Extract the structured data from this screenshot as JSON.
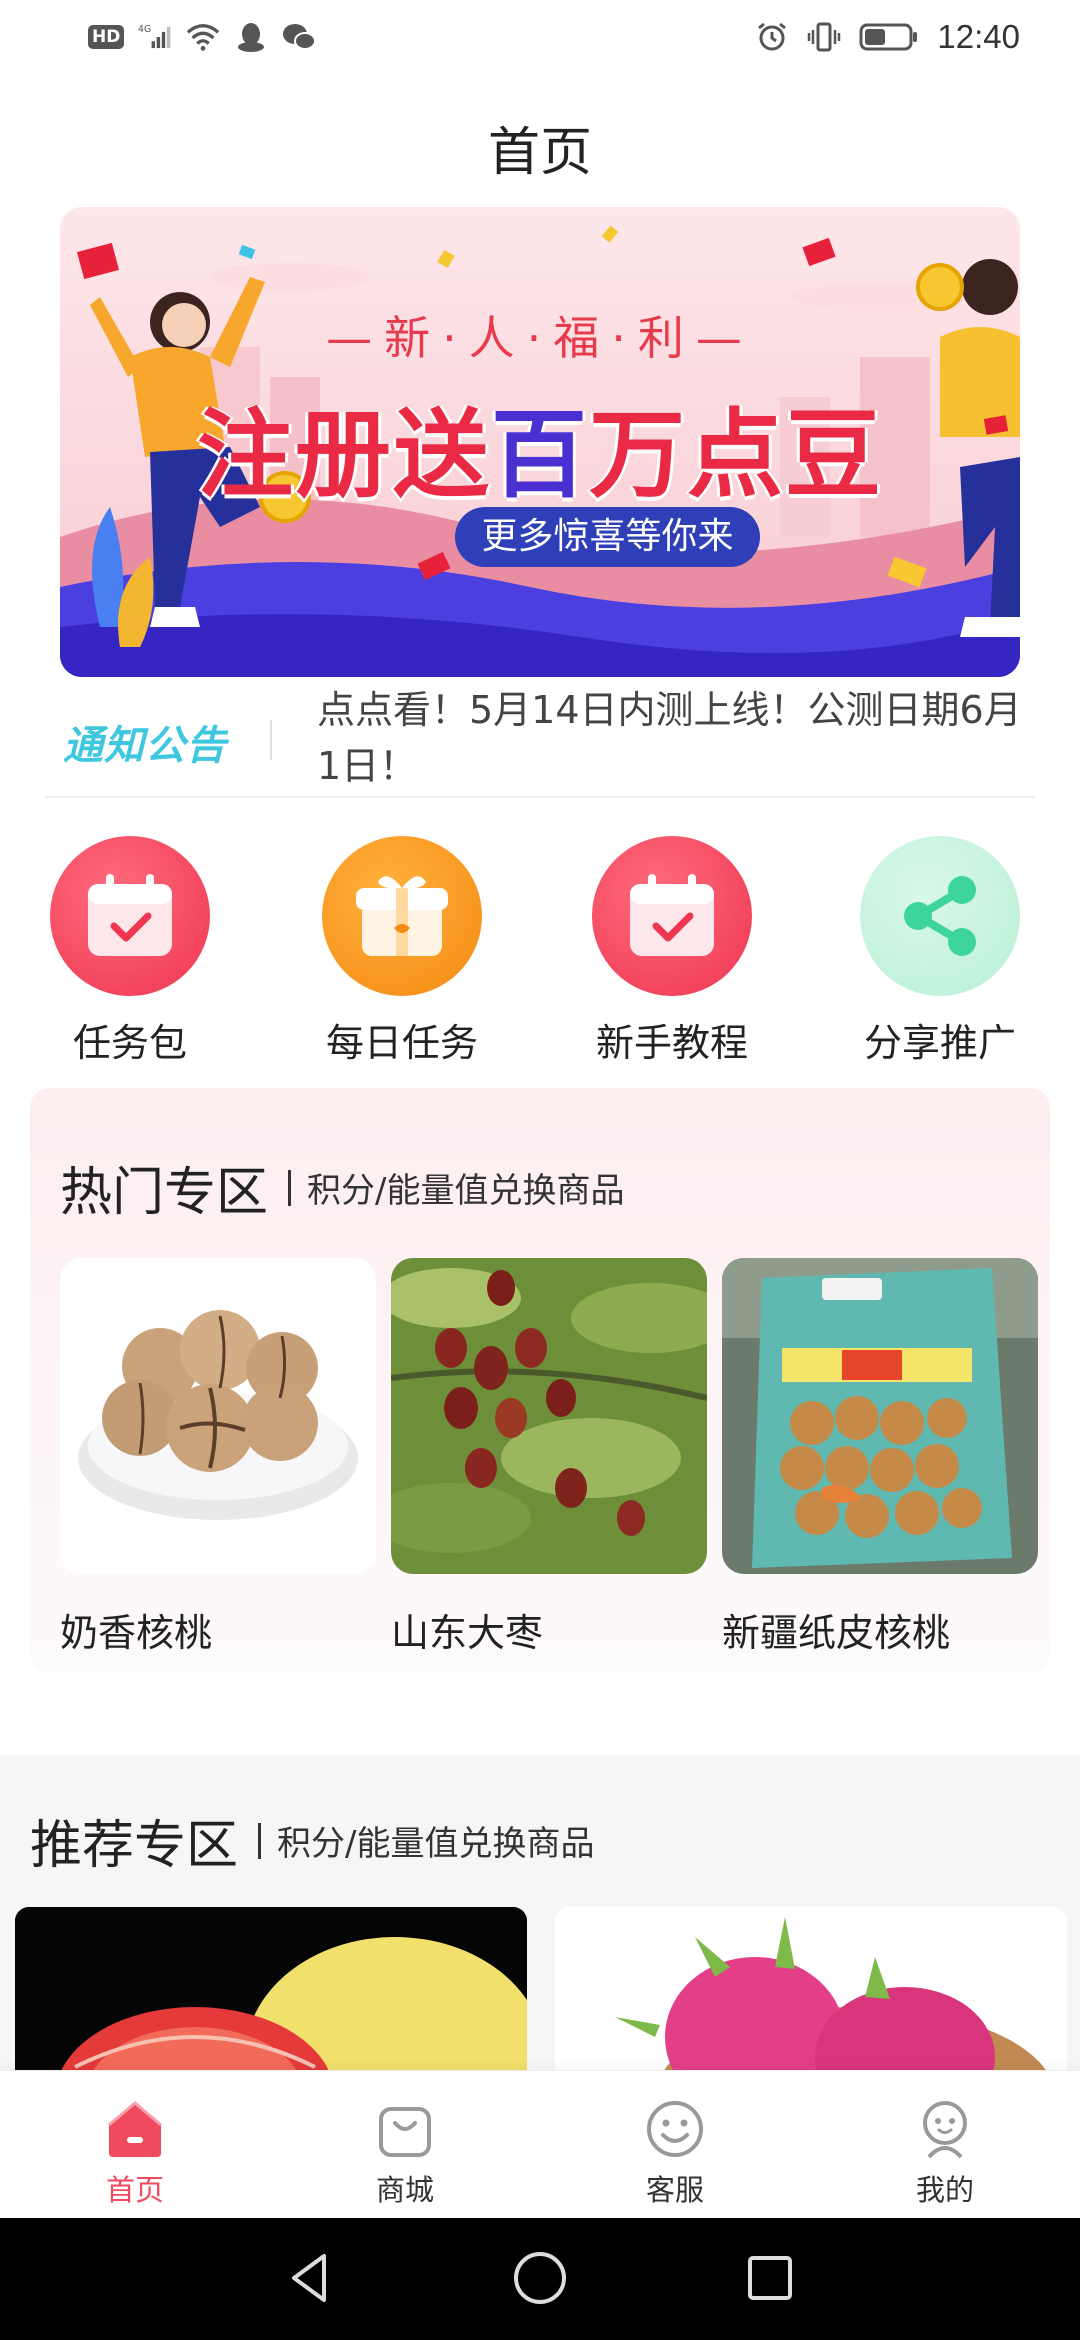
{
  "status_bar": {
    "hd": "HD",
    "network": "4G",
    "time": "12:40"
  },
  "header": {
    "title": "首页"
  },
  "banner": {
    "subtitle": "—新·人·福·利—",
    "main_prefix": "注册送",
    "main_emphasis": "百",
    "main_suffix": "万点豆",
    "pill": "更多惊喜等你来"
  },
  "notice": {
    "logo": "通知公告",
    "text": "点点看！5月14日内测上线！公测日期6月1日！"
  },
  "quick_menu": {
    "items": [
      {
        "label": "任务包",
        "icon": "calendar-check-icon",
        "color": "#f0435a"
      },
      {
        "label": "每日任务",
        "icon": "gift-box-icon",
        "color": "#f7931f"
      },
      {
        "label": "新手教程",
        "icon": "calendar-check-icon",
        "color": "#f0435a"
      },
      {
        "label": "分享推广",
        "icon": "share-icon",
        "color": "#3ed59a"
      }
    ]
  },
  "hot_zone": {
    "title": "热门专区",
    "subtitle": "积分/能量值兑换商品",
    "products": [
      {
        "name": "奶香核桃"
      },
      {
        "name": "山东大枣"
      },
      {
        "name": "新疆纸皮核桃"
      }
    ]
  },
  "recommend_zone": {
    "title": "推荐专区",
    "subtitle": "积分/能量值兑换商品"
  },
  "tab_bar": {
    "tabs": [
      {
        "label": "首页",
        "icon": "home-icon"
      },
      {
        "label": "商城",
        "icon": "shopping-bag-icon"
      },
      {
        "label": "客服",
        "icon": "smiley-icon"
      },
      {
        "label": "我的",
        "icon": "user-icon"
      }
    ],
    "active": "首页",
    "accent": "#ef4a5e"
  },
  "nav_bar": {
    "buttons": [
      "back",
      "home",
      "recents"
    ]
  }
}
